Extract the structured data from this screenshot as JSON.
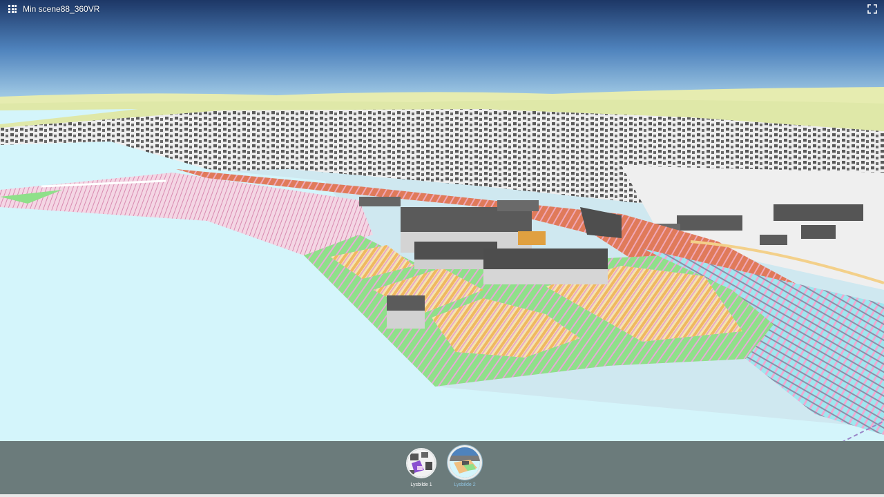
{
  "app": {
    "title": "Min scene88_360VR"
  },
  "icons": {
    "apps": "apps-grid-icon",
    "fullscreen": "fullscreen-icon"
  },
  "slides": [
    {
      "label": "Lysbilde 1",
      "active": false
    },
    {
      "label": "Lysbilde 2",
      "active": true
    }
  ],
  "colors": {
    "sky_top": "#1e3a6b",
    "sky_bottom": "#a8d4ec",
    "water": "#d4f5fb",
    "slidebar": "#6b7b7b",
    "active_label": "#8fc3e0",
    "zone_orange": "#e07a5a",
    "zone_green": "#8fe08a",
    "zone_yellow": "#f2d58a",
    "zone_pink": "#f2a8c4",
    "building": "#555555"
  }
}
